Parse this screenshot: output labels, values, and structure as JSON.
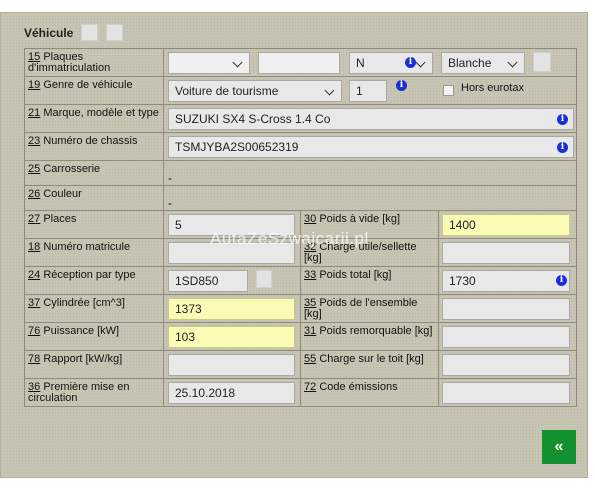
{
  "section_title": "Véhicule",
  "watermark": "AutaZeSzwajcarii.pl",
  "rows": {
    "plates": {
      "num": "15",
      "label": "Plaques d'immatriculation",
      "state": "",
      "number": "",
      "letter": "N",
      "color": "Blanche"
    },
    "genre": {
      "num": "19",
      "label": "Genre de véhicule",
      "value": "Voiture de tourisme",
      "qty": "1",
      "hors_label": "Hors eurotax"
    },
    "marque": {
      "num": "21",
      "label": "Marque, modèle et type",
      "value": "SUZUKI SX4 S-Cross 1.4 Co"
    },
    "chassis": {
      "num": "23",
      "label": "Numéro de chassis",
      "value": "TSMJYBA2S00652319"
    },
    "carrosserie": {
      "num": "25",
      "label": "Carrosserie",
      "value": "-"
    },
    "couleur": {
      "num": "26",
      "label": "Couleur",
      "value": "-"
    },
    "places": {
      "num": "27",
      "label": "Places",
      "value": "5"
    },
    "poids_vide": {
      "num": "30",
      "label": "Poids à vide [kg]",
      "value": "1400"
    },
    "matricule": {
      "num": "18",
      "label": "Numéro matricule",
      "value": ""
    },
    "charge_utile": {
      "num": "32",
      "label": "Charge utile/sellette [kg]",
      "value": ""
    },
    "reception": {
      "num": "24",
      "label": "Réception par type",
      "value": "1SD850"
    },
    "poids_total": {
      "num": "33",
      "label": "Poids total [kg]",
      "value": "1730"
    },
    "cylindree": {
      "num": "37",
      "label": "Cylindrée [cm^3]",
      "value": "1373"
    },
    "poids_ensemble": {
      "num": "35",
      "label": "Poids de l'ensemble [kg]",
      "value": ""
    },
    "puissance": {
      "num": "76",
      "label": "Puissance [kW]",
      "value": "103"
    },
    "poids_remorquable": {
      "num": "31",
      "label": "Poids remorquable [kg]",
      "value": ""
    },
    "rapport": {
      "num": "78",
      "label": "Rapport [kW/kg]",
      "value": ""
    },
    "charge_toit": {
      "num": "55",
      "label": "Charge sur le toit [kg]",
      "value": ""
    },
    "premiere": {
      "num": "36",
      "label": "Première mise en circulation",
      "value": "25.10.2018"
    },
    "code_emissions": {
      "num": "72",
      "label": "Code émissions",
      "value": ""
    }
  },
  "back_button": "«",
  "info_icon": "i",
  "colors": {
    "panel": "#c8c4b4",
    "highlight": "#fbfbb6",
    "button": "#14912f",
    "info": "#1a2fd6"
  }
}
